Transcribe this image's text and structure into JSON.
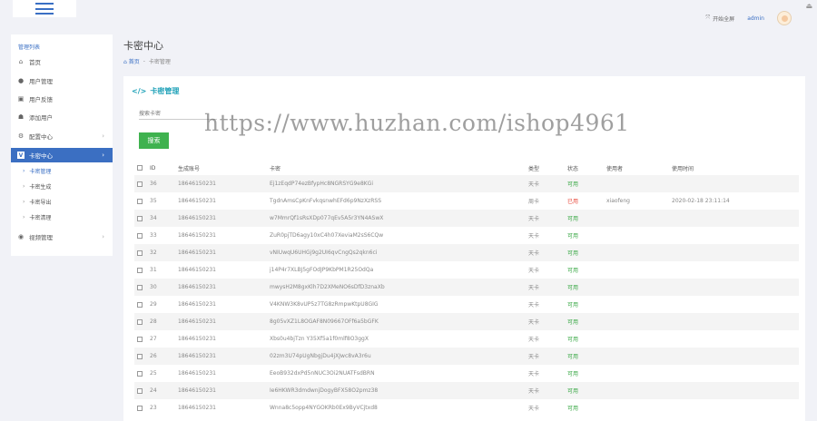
{
  "topbar": {
    "fullscreen_label": "开始全屏",
    "admin_name": "admin"
  },
  "sidebar": {
    "title": "管理列表",
    "items": [
      {
        "label": "首页",
        "icon": "home-icon"
      },
      {
        "label": "用户管理",
        "icon": "user-icon"
      },
      {
        "label": "用户反馈",
        "icon": "edit-icon"
      },
      {
        "label": "添加用户",
        "icon": "users-icon"
      },
      {
        "label": "配置中心",
        "icon": "gear-icon"
      },
      {
        "label": "卡密中心",
        "icon": "v-icon"
      },
      {
        "label": "视频管理",
        "icon": "play-icon"
      }
    ],
    "subitems": [
      {
        "label": "卡密管理"
      },
      {
        "label": "卡密生成"
      },
      {
        "label": "卡密导出"
      },
      {
        "label": "卡密清理"
      }
    ]
  },
  "page": {
    "title": "卡密中心",
    "crumb_home": "首页",
    "crumb_sep": "-",
    "crumb_current": "卡密管理"
  },
  "panel": {
    "title": "卡密管理",
    "search_placeholder": "搜索卡密",
    "search_button": "搜索"
  },
  "watermark": "https://www.huzhan.com/ishop4961",
  "table": {
    "headers": {
      "id": "ID",
      "account": "生成账号",
      "card": "卡密",
      "type": "类型",
      "status": "状态",
      "user": "使用者",
      "time": "使用时间"
    },
    "rows": [
      {
        "id": "36",
        "account": "18646150231",
        "card": "Ej1zEqdP74ezBfypHc8NGRSYG9e8KGi",
        "type": "天卡",
        "status": "可用",
        "user": "",
        "time": ""
      },
      {
        "id": "35",
        "account": "18646150231",
        "card": "TgdnAmsCpKnFvkqsnwhEFd6p9NzXzRSS",
        "type": "周卡",
        "status": "已用",
        "user": "xiaofeng",
        "time": "2020-02-18 23:11:14"
      },
      {
        "id": "34",
        "account": "18646150231",
        "card": "w7MmrQf1sRsXDp077qEv5A5r3YN4ASwX",
        "type": "天卡",
        "status": "可用",
        "user": "",
        "time": ""
      },
      {
        "id": "33",
        "account": "18646150231",
        "card": "ZuR0pjTD6agy10xC4h07XeviaM2sS6CQw",
        "type": "天卡",
        "status": "可用",
        "user": "",
        "time": ""
      },
      {
        "id": "32",
        "account": "18646150231",
        "card": "vNIUwqU6UHGj9g2UI6qvCngQs2qkn6ci",
        "type": "天卡",
        "status": "可用",
        "user": "",
        "time": ""
      },
      {
        "id": "31",
        "account": "18646150231",
        "card": "j14P4r7XLBJ5gFOdJP9KbPM1R25OdQa",
        "type": "天卡",
        "status": "可用",
        "user": "",
        "time": ""
      },
      {
        "id": "30",
        "account": "18646150231",
        "card": "mwysH2M8gxKlh7D2XMeNO6sDfD3znaXb",
        "type": "天卡",
        "status": "可用",
        "user": "",
        "time": ""
      },
      {
        "id": "29",
        "account": "18646150231",
        "card": "V4KNW3K8vUP5z7TG8zRmpwKtpU8GIG",
        "type": "天卡",
        "status": "可用",
        "user": "",
        "time": ""
      },
      {
        "id": "28",
        "account": "18646150231",
        "card": "8g05vXZ1L8OGAF8N09667OFf6a5bGFK",
        "type": "天卡",
        "status": "可用",
        "user": "",
        "time": ""
      },
      {
        "id": "27",
        "account": "18646150231",
        "card": "Xbs0u4bjTzn Y35Xf5a1f0mlf8O3ggX",
        "type": "天卡",
        "status": "可用",
        "user": "",
        "time": ""
      },
      {
        "id": "26",
        "account": "18646150231",
        "card": "02zm3U74pUgNbgjDu4jXJwc8vA3r6u",
        "type": "天卡",
        "status": "可用",
        "user": "",
        "time": ""
      },
      {
        "id": "25",
        "account": "18646150231",
        "card": "EeoB932dxPd5nNUC3Oi2NUATFsdBRN",
        "type": "天卡",
        "status": "可用",
        "user": "",
        "time": ""
      },
      {
        "id": "24",
        "account": "18646150231",
        "card": "Ie6HKWR3dmdwnjDogyBFX58O2pmz38",
        "type": "天卡",
        "status": "可用",
        "user": "",
        "time": ""
      },
      {
        "id": "23",
        "account": "18646150231",
        "card": "Wnna8c5opp4NYGOKRb0Ex9ByVCjtxd8",
        "type": "天卡",
        "status": "可用",
        "user": "",
        "time": ""
      }
    ]
  },
  "colors": {
    "accent": "#3b6fc2",
    "ok": "#39a845",
    "used": "#e84a3c",
    "teal": "#1fa1b8",
    "search_btn": "#3fb24f"
  }
}
